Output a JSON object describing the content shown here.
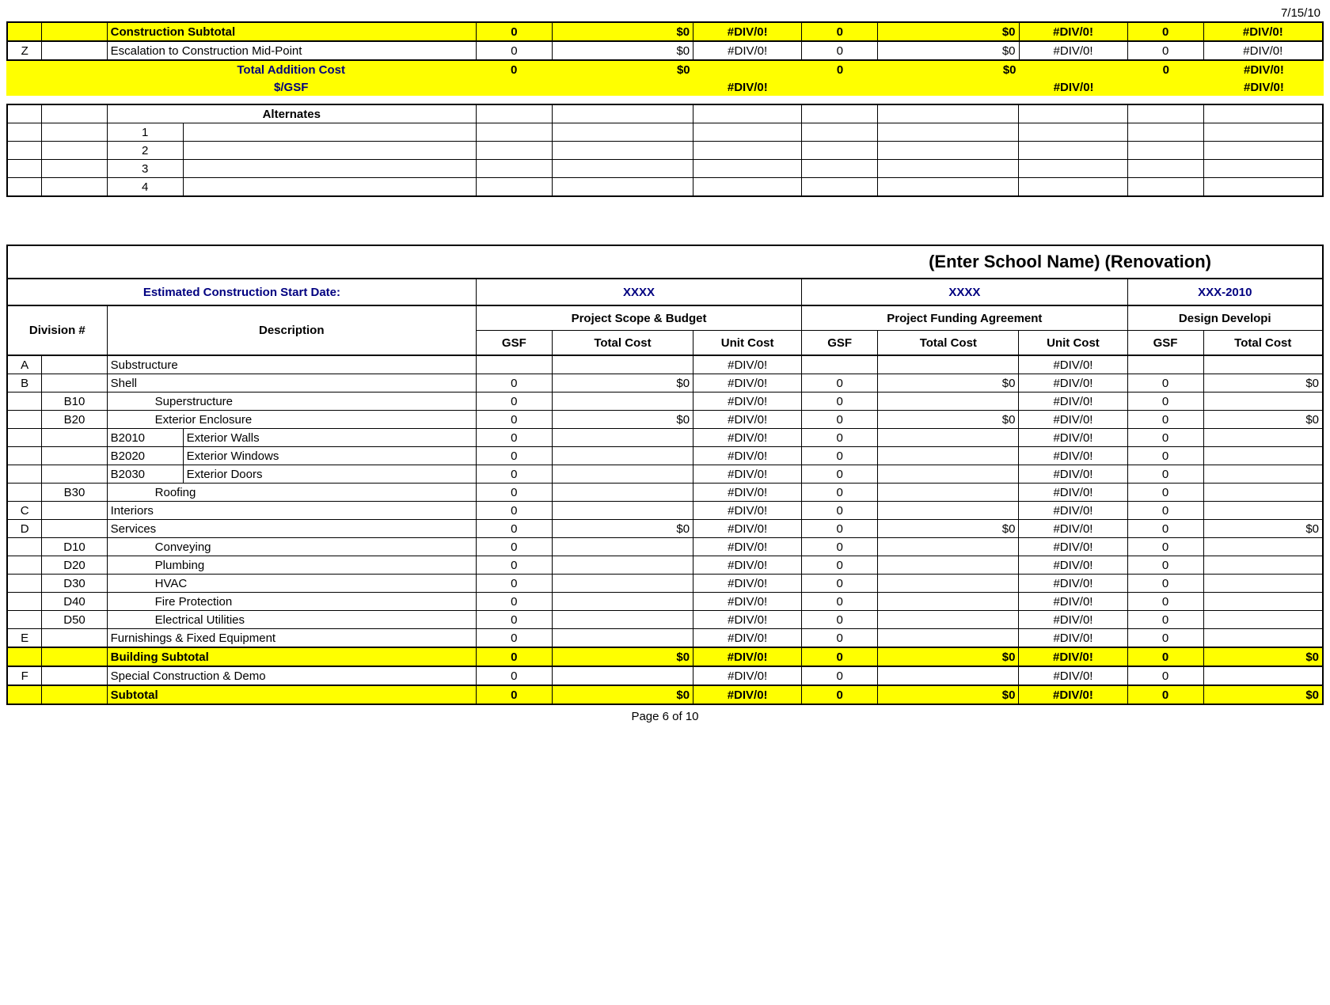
{
  "date_top": "7/15/10",
  "top": {
    "construction_subtotal_label": "Construction Subtotal",
    "escalation_code": "Z",
    "escalation_label": "Escalation to Construction Mid-Point",
    "total_addition_label": "Total Addition Cost",
    "per_gsf_label": "$/GSF",
    "vals": {
      "cs": [
        "0",
        "$0",
        "#DIV/0!",
        "0",
        "$0",
        "#DIV/0!",
        "0",
        "#DIV/0!"
      ],
      "esc": [
        "0",
        "$0",
        "#DIV/0!",
        "0",
        "$0",
        "#DIV/0!",
        "0",
        "#DIV/0!"
      ],
      "tac": [
        "0",
        "$0",
        "0",
        "$0",
        "0",
        "#DIV/0!"
      ],
      "pg": [
        "#DIV/0!",
        "#DIV/0!",
        "#DIV/0!"
      ]
    }
  },
  "alternates": {
    "header": "Alternates",
    "rows": [
      "1",
      "2",
      "3",
      "4"
    ]
  },
  "lower": {
    "title": "(Enter School Name) (Renovation)",
    "start_date_label": "Estimated Construction Start Date:",
    "dates": [
      "XXXX",
      "XXXX",
      "XXX-2010"
    ],
    "division_label": "Division #",
    "description_label": "Description",
    "groups": [
      "Project Scope & Budget",
      "Project Funding Agreement",
      "Design Developi"
    ],
    "subcols": [
      "GSF",
      "Total Cost",
      "Unit Cost"
    ],
    "building_subtotal_label": "Building Subtotal",
    "special_label": "Special Construction & Demo",
    "special_code": "F",
    "subtotal_label": "Subtotal",
    "rows": [
      {
        "c1": "A",
        "c2": "",
        "c3": "",
        "desc": "Substructure",
        "v": [
          "",
          "",
          "#DIV/0!",
          "",
          "",
          "#DIV/0!",
          "",
          ""
        ]
      },
      {
        "c1": "B",
        "c2": "",
        "c3": "",
        "desc": "Shell",
        "v": [
          "0",
          "$0",
          "#DIV/0!",
          "0",
          "$0",
          "#DIV/0!",
          "0",
          "$0"
        ]
      },
      {
        "c1": "",
        "c2": "B10",
        "c3": "",
        "desc": "Superstructure",
        "indent": 1,
        "v": [
          "0",
          "",
          "#DIV/0!",
          "0",
          "",
          "#DIV/0!",
          "0",
          ""
        ]
      },
      {
        "c1": "",
        "c2": "B20",
        "c3": "",
        "desc": "Exterior Enclosure",
        "indent": 1,
        "v": [
          "0",
          "$0",
          "#DIV/0!",
          "0",
          "$0",
          "#DIV/0!",
          "0",
          "$0"
        ]
      },
      {
        "c1": "",
        "c2": "",
        "c3": "B2010",
        "desc": "Exterior Walls",
        "v": [
          "0",
          "",
          "#DIV/0!",
          "0",
          "",
          "#DIV/0!",
          "0",
          ""
        ]
      },
      {
        "c1": "",
        "c2": "",
        "c3": "B2020",
        "desc": "Exterior Windows",
        "v": [
          "0",
          "",
          "#DIV/0!",
          "0",
          "",
          "#DIV/0!",
          "0",
          ""
        ]
      },
      {
        "c1": "",
        "c2": "",
        "c3": "B2030",
        "desc": "Exterior Doors",
        "v": [
          "0",
          "",
          "#DIV/0!",
          "0",
          "",
          "#DIV/0!",
          "0",
          ""
        ]
      },
      {
        "c1": "",
        "c2": "B30",
        "c3": "",
        "desc": "Roofing",
        "indent": 1,
        "v": [
          "0",
          "",
          "#DIV/0!",
          "0",
          "",
          "#DIV/0!",
          "0",
          ""
        ]
      },
      {
        "c1": "C",
        "c2": "",
        "c3": "",
        "desc": "Interiors",
        "v": [
          "0",
          "",
          "#DIV/0!",
          "0",
          "",
          "#DIV/0!",
          "0",
          ""
        ]
      },
      {
        "c1": "D",
        "c2": "",
        "c3": "",
        "desc": "Services",
        "v": [
          "0",
          "$0",
          "#DIV/0!",
          "0",
          "$0",
          "#DIV/0!",
          "0",
          "$0"
        ]
      },
      {
        "c1": "",
        "c2": "D10",
        "c3": "",
        "desc": "Conveying",
        "indent": 1,
        "v": [
          "0",
          "",
          "#DIV/0!",
          "0",
          "",
          "#DIV/0!",
          "0",
          ""
        ]
      },
      {
        "c1": "",
        "c2": "D20",
        "c3": "",
        "desc": "Plumbing",
        "indent": 1,
        "v": [
          "0",
          "",
          "#DIV/0!",
          "0",
          "",
          "#DIV/0!",
          "0",
          ""
        ]
      },
      {
        "c1": "",
        "c2": "D30",
        "c3": "",
        "desc": "HVAC",
        "indent": 1,
        "v": [
          "0",
          "",
          "#DIV/0!",
          "0",
          "",
          "#DIV/0!",
          "0",
          ""
        ]
      },
      {
        "c1": "",
        "c2": "D40",
        "c3": "",
        "desc": "Fire Protection",
        "indent": 1,
        "v": [
          "0",
          "",
          "#DIV/0!",
          "0",
          "",
          "#DIV/0!",
          "0",
          ""
        ]
      },
      {
        "c1": "",
        "c2": "D50",
        "c3": "",
        "desc": "Electrical Utilities",
        "indent": 1,
        "v": [
          "0",
          "",
          "#DIV/0!",
          "0",
          "",
          "#DIV/0!",
          "0",
          ""
        ]
      },
      {
        "c1": "E",
        "c2": "",
        "c3": "",
        "desc": "Furnishings & Fixed Equipment",
        "v": [
          "0",
          "",
          "#DIV/0!",
          "0",
          "",
          "#DIV/0!",
          "0",
          ""
        ]
      }
    ],
    "building_subtotal_vals": [
      "0",
      "$0",
      "#DIV/0!",
      "0",
      "$0",
      "#DIV/0!",
      "0",
      "$0"
    ],
    "special_vals": [
      "0",
      "",
      "#DIV/0!",
      "0",
      "",
      "#DIV/0!",
      "0",
      ""
    ],
    "subtotal_vals": [
      "0",
      "$0",
      "#DIV/0!",
      "0",
      "$0",
      "#DIV/0!",
      "0",
      "$0"
    ]
  },
  "footer": "Page 6 of 10"
}
